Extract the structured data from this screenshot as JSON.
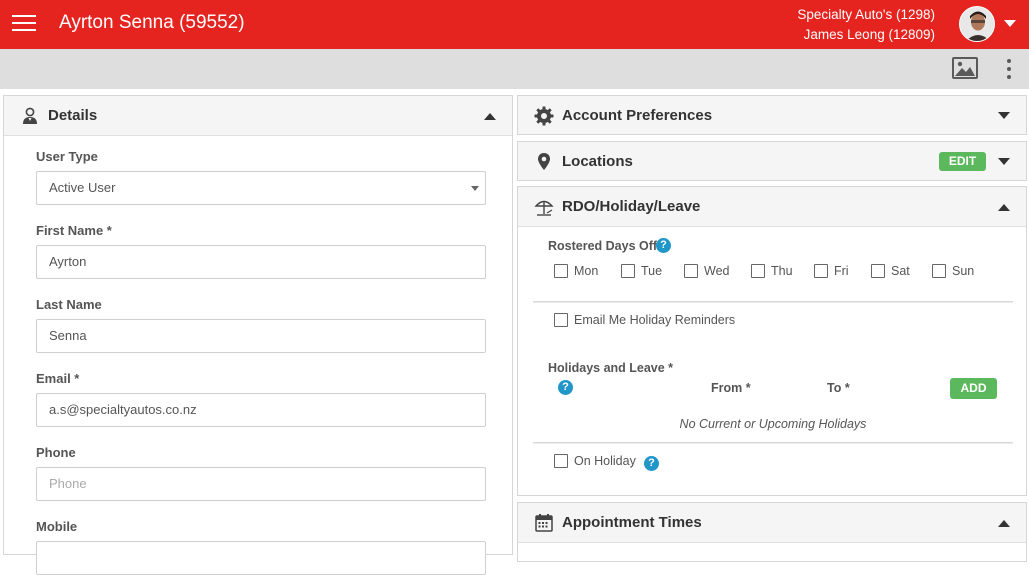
{
  "header": {
    "title": "Ayrton Senna (59552)",
    "company": "Specialty Auto's (1298)",
    "user": "James Leong (12809)",
    "brand_color": "#e5231f",
    "icons": [
      "hamburger-menu-icon",
      "avatar",
      "chevron-down-icon"
    ]
  },
  "toolbar": {
    "icons": [
      "image-icon",
      "kebab-menu-icon"
    ]
  },
  "details": {
    "title": "Details",
    "icon": "user-icon",
    "fields": {
      "user_type": {
        "label": "User Type",
        "value": "Active User"
      },
      "first_name": {
        "label": "First Name *",
        "value": "Ayrton"
      },
      "last_name": {
        "label": "Last Name",
        "value": "Senna"
      },
      "email": {
        "label": "Email *",
        "value": "a.s@specialtyautos.co.nz"
      },
      "phone": {
        "label": "Phone",
        "placeholder": "Phone"
      },
      "mobile": {
        "label": "Mobile"
      }
    }
  },
  "account_preferences": {
    "title": "Account Preferences",
    "icon": "gear-icon"
  },
  "locations": {
    "title": "Locations",
    "icon": "map-pin-icon",
    "edit_label": "EDIT"
  },
  "rdo": {
    "title": "RDO/Holiday/Leave",
    "icon": "beach-umbrella-icon",
    "rostered_days_label": "Rostered Days Off",
    "days": [
      "Mon",
      "Tue",
      "Wed",
      "Thu",
      "Fri",
      "Sat",
      "Sun"
    ],
    "email_reminders_label": "Email Me Holiday Reminders",
    "holidays_label": "Holidays and Leave *",
    "from_label": "From *",
    "to_label": "To *",
    "add_label": "ADD",
    "empty_message": "No Current or Upcoming Holidays",
    "on_holiday_label": "On Holiday",
    "help_glyph": "?"
  },
  "appointment_times": {
    "title": "Appointment Times",
    "icon": "calendar-icon"
  }
}
